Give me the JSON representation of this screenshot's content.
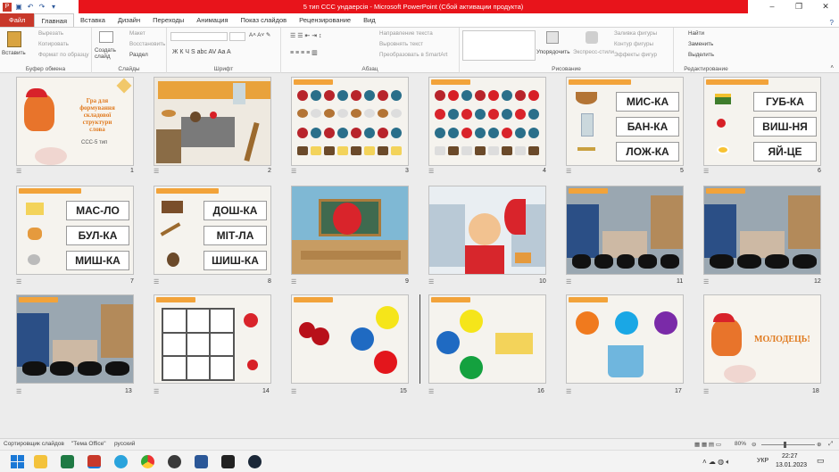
{
  "window": {
    "title": "5 тип ССС ундаерсія  -  Microsoft PowerPoint (Сбой активации продукта)"
  },
  "tabs": [
    "Файл",
    "Главная",
    "Вставка",
    "Дизайн",
    "Переходы",
    "Анимация",
    "Показ слайдов",
    "Рецензирование",
    "Вид"
  ],
  "ribbon": {
    "clipboard": {
      "paste": "Вставить",
      "cut": "Вырезать",
      "copy": "Копировать",
      "format": "Формат по образцу",
      "label": "Буфер обмена"
    },
    "slides": {
      "new_slide": "Создать слайд",
      "layout": "Макет",
      "reset": "Восстановить",
      "section": "Раздел",
      "label": "Слайды"
    },
    "font": {
      "label": "Шрифт"
    },
    "paragraph": {
      "text_direction": "Направление текста",
      "align_text": "Выровнять текст",
      "smartart": "Преобразовать в SmartArt",
      "label": "Абзац"
    },
    "drawing": {
      "arrange": "Упорядочить",
      "quick_styles": "Экспресс-стили",
      "fill": "Заливка фигуры",
      "outline": "Контур фигуры",
      "effects": "Эффекты фигур",
      "label": "Рисование"
    },
    "editing": {
      "find": "Найти",
      "replace": "Заменить",
      "select": "Выделить",
      "label": "Редактирование"
    }
  },
  "slides": [
    {
      "n": "1",
      "title_lines": [
        "Гра для",
        "формування",
        "складової",
        "структури",
        "слова"
      ],
      "subtitle": "ССС-5 тип"
    },
    {
      "n": "2"
    },
    {
      "n": "3"
    },
    {
      "n": "4"
    },
    {
      "n": "5",
      "words": [
        "МИС-КА",
        "БАН-КА",
        "ЛОЖ-КА"
      ]
    },
    {
      "n": "6",
      "words": [
        "ГУБ-КА",
        "ВИШ-НЯ",
        "ЯЙ-ЦЕ"
      ]
    },
    {
      "n": "7",
      "words": [
        "МАС-ЛО",
        "БУЛ-КА",
        "МИШ-КА"
      ]
    },
    {
      "n": "8",
      "words": [
        "ДОШ-КА",
        "МІТ-ЛА",
        "ШИШ-КА"
      ]
    },
    {
      "n": "9"
    },
    {
      "n": "10"
    },
    {
      "n": "11"
    },
    {
      "n": "12"
    },
    {
      "n": "13"
    },
    {
      "n": "14"
    },
    {
      "n": "15"
    },
    {
      "n": "16"
    },
    {
      "n": "17"
    },
    {
      "n": "18",
      "text": "МОЛОДЕЦЬ!"
    }
  ],
  "statusbar": {
    "view": "Сортировщик слайдов",
    "theme": "\"Тема Office\"",
    "lang": "русский",
    "zoom": "80%"
  },
  "taskbar": {
    "lang": "УКР",
    "time": "22:27",
    "date": "13.01.2023"
  },
  "colors": {
    "accent": "#c8382a",
    "title_red": "#e8141b",
    "banner": "#f2a33a"
  }
}
